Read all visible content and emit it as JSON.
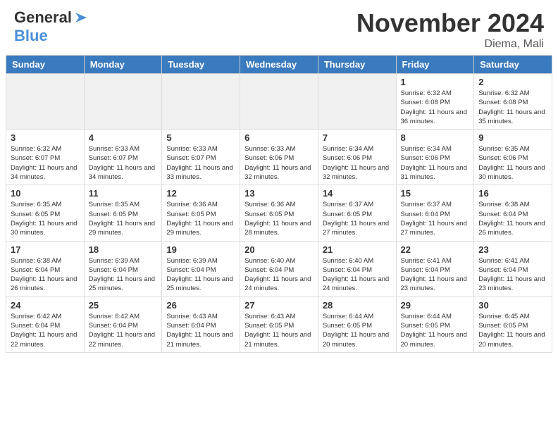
{
  "header": {
    "logo_general": "General",
    "logo_blue": "Blue",
    "month_title": "November 2024",
    "location": "Diema, Mali"
  },
  "weekdays": [
    "Sunday",
    "Monday",
    "Tuesday",
    "Wednesday",
    "Thursday",
    "Friday",
    "Saturday"
  ],
  "weeks": [
    [
      {
        "day": "",
        "info": "",
        "empty": true
      },
      {
        "day": "",
        "info": "",
        "empty": true
      },
      {
        "day": "",
        "info": "",
        "empty": true
      },
      {
        "day": "",
        "info": "",
        "empty": true
      },
      {
        "day": "",
        "info": "",
        "empty": true
      },
      {
        "day": "1",
        "info": "Sunrise: 6:32 AM\nSunset: 6:08 PM\nDaylight: 11 hours and 36 minutes."
      },
      {
        "day": "2",
        "info": "Sunrise: 6:32 AM\nSunset: 6:08 PM\nDaylight: 11 hours and 35 minutes."
      }
    ],
    [
      {
        "day": "3",
        "info": "Sunrise: 6:32 AM\nSunset: 6:07 PM\nDaylight: 11 hours and 34 minutes."
      },
      {
        "day": "4",
        "info": "Sunrise: 6:33 AM\nSunset: 6:07 PM\nDaylight: 11 hours and 34 minutes."
      },
      {
        "day": "5",
        "info": "Sunrise: 6:33 AM\nSunset: 6:07 PM\nDaylight: 11 hours and 33 minutes."
      },
      {
        "day": "6",
        "info": "Sunrise: 6:33 AM\nSunset: 6:06 PM\nDaylight: 11 hours and 32 minutes."
      },
      {
        "day": "7",
        "info": "Sunrise: 6:34 AM\nSunset: 6:06 PM\nDaylight: 11 hours and 32 minutes."
      },
      {
        "day": "8",
        "info": "Sunrise: 6:34 AM\nSunset: 6:06 PM\nDaylight: 11 hours and 31 minutes."
      },
      {
        "day": "9",
        "info": "Sunrise: 6:35 AM\nSunset: 6:06 PM\nDaylight: 11 hours and 30 minutes."
      }
    ],
    [
      {
        "day": "10",
        "info": "Sunrise: 6:35 AM\nSunset: 6:05 PM\nDaylight: 11 hours and 30 minutes."
      },
      {
        "day": "11",
        "info": "Sunrise: 6:35 AM\nSunset: 6:05 PM\nDaylight: 11 hours and 29 minutes."
      },
      {
        "day": "12",
        "info": "Sunrise: 6:36 AM\nSunset: 6:05 PM\nDaylight: 11 hours and 29 minutes."
      },
      {
        "day": "13",
        "info": "Sunrise: 6:36 AM\nSunset: 6:05 PM\nDaylight: 11 hours and 28 minutes."
      },
      {
        "day": "14",
        "info": "Sunrise: 6:37 AM\nSunset: 6:05 PM\nDaylight: 11 hours and 27 minutes."
      },
      {
        "day": "15",
        "info": "Sunrise: 6:37 AM\nSunset: 6:04 PM\nDaylight: 11 hours and 27 minutes."
      },
      {
        "day": "16",
        "info": "Sunrise: 6:38 AM\nSunset: 6:04 PM\nDaylight: 11 hours and 26 minutes."
      }
    ],
    [
      {
        "day": "17",
        "info": "Sunrise: 6:38 AM\nSunset: 6:04 PM\nDaylight: 11 hours and 26 minutes."
      },
      {
        "day": "18",
        "info": "Sunrise: 6:39 AM\nSunset: 6:04 PM\nDaylight: 11 hours and 25 minutes."
      },
      {
        "day": "19",
        "info": "Sunrise: 6:39 AM\nSunset: 6:04 PM\nDaylight: 11 hours and 25 minutes."
      },
      {
        "day": "20",
        "info": "Sunrise: 6:40 AM\nSunset: 6:04 PM\nDaylight: 11 hours and 24 minutes."
      },
      {
        "day": "21",
        "info": "Sunrise: 6:40 AM\nSunset: 6:04 PM\nDaylight: 11 hours and 24 minutes."
      },
      {
        "day": "22",
        "info": "Sunrise: 6:41 AM\nSunset: 6:04 PM\nDaylight: 11 hours and 23 minutes."
      },
      {
        "day": "23",
        "info": "Sunrise: 6:41 AM\nSunset: 6:04 PM\nDaylight: 11 hours and 23 minutes."
      }
    ],
    [
      {
        "day": "24",
        "info": "Sunrise: 6:42 AM\nSunset: 6:04 PM\nDaylight: 11 hours and 22 minutes."
      },
      {
        "day": "25",
        "info": "Sunrise: 6:42 AM\nSunset: 6:04 PM\nDaylight: 11 hours and 22 minutes."
      },
      {
        "day": "26",
        "info": "Sunrise: 6:43 AM\nSunset: 6:04 PM\nDaylight: 11 hours and 21 minutes."
      },
      {
        "day": "27",
        "info": "Sunrise: 6:43 AM\nSunset: 6:05 PM\nDaylight: 11 hours and 21 minutes."
      },
      {
        "day": "28",
        "info": "Sunrise: 6:44 AM\nSunset: 6:05 PM\nDaylight: 11 hours and 20 minutes."
      },
      {
        "day": "29",
        "info": "Sunrise: 6:44 AM\nSunset: 6:05 PM\nDaylight: 11 hours and 20 minutes."
      },
      {
        "day": "30",
        "info": "Sunrise: 6:45 AM\nSunset: 6:05 PM\nDaylight: 11 hours and 20 minutes."
      }
    ]
  ]
}
